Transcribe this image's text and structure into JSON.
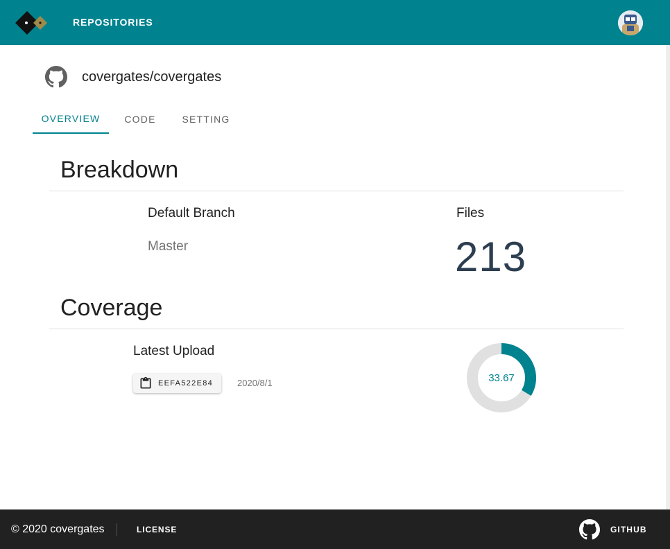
{
  "colors": {
    "accent": "#00838f",
    "footer_bg": "#212121",
    "donut_track": "#e0e0e0"
  },
  "appbar": {
    "nav_label": "REPOSITORIES",
    "logo_icon": "diamond-logo-icon",
    "avatar_icon": "user-avatar-icon"
  },
  "repo": {
    "icon": "github-icon",
    "full_name": "covergates/covergates"
  },
  "tabs": [
    {
      "label": "OVERVIEW",
      "active": true
    },
    {
      "label": "CODE",
      "active": false
    },
    {
      "label": "SETTING",
      "active": false
    }
  ],
  "breakdown": {
    "title": "Breakdown",
    "default_branch_label": "Default Branch",
    "default_branch_value": "Master",
    "files_label": "Files",
    "files_value": "213"
  },
  "coverage": {
    "title": "Coverage",
    "latest_upload_label": "Latest Upload",
    "commit_icon": "clipboard-icon",
    "commit_sha": "EEFA522E84",
    "upload_date": "2020/8/1",
    "percent_label": "33.67",
    "percent_value": 33.67
  },
  "footer": {
    "copyright": "© 2020 covergates",
    "license_label": "LICENSE",
    "github_icon": "github-icon",
    "github_label": "GITHUB"
  }
}
